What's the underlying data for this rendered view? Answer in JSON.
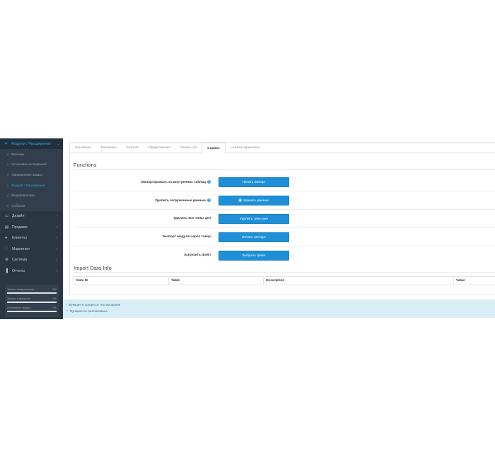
{
  "sidebar": {
    "header": {
      "label": "Модули / Расширения",
      "icon": "puzzle-icon"
    },
    "subitems": [
      {
        "label": "Магазин",
        "active": false
      },
      {
        "label": "Установка расширений",
        "active": false
      },
      {
        "label": "Оформление заказа",
        "active": false
      },
      {
        "label": "Модули / Расширения",
        "active": true
      },
      {
        "label": "Модификаторы",
        "active": false
      },
      {
        "label": "События",
        "active": false
      }
    ],
    "items": [
      {
        "label": "Дизайн",
        "icon": "monitor-icon"
      },
      {
        "label": "Продажи",
        "icon": "cart-icon"
      },
      {
        "label": "Клиенты",
        "icon": "user-icon"
      },
      {
        "label": "Маркетинг",
        "icon": "share-icon"
      },
      {
        "label": "Система",
        "icon": "gear-icon"
      },
      {
        "label": "Отчеты",
        "icon": "chart-icon"
      }
    ],
    "stats": [
      {
        "label": "Заказы завершенные",
        "pct": "0%",
        "value": 0
      },
      {
        "label": "Заказы в процессе",
        "pct": "0%",
        "value": 0
      },
      {
        "label": "Остальные заказы",
        "pct": "0%",
        "value": 0
      }
    ]
  },
  "tabs": [
    {
      "label": "Основные",
      "active": false
    },
    {
      "label": "Магазины",
      "active": false
    },
    {
      "label": "Каталог",
      "active": false
    },
    {
      "label": "Предложения",
      "active": false
    },
    {
      "label": "Заказы (0)",
      "active": false
    },
    {
      "label": "Сервис",
      "active": true
    },
    {
      "label": "License Agreement",
      "active": false
    }
  ],
  "functions": {
    "title": "Functions",
    "rows": [
      {
        "label": "Импортировать из внутренних таблиц",
        "help": true,
        "button": "Начать импорт",
        "trash": false
      },
      {
        "label": "Удалить загруженные данные",
        "help": true,
        "button": "Удалить данные",
        "trash": true
      },
      {
        "label": "Удалить все типы цен",
        "help": false,
        "button": "Удалить типы цен",
        "trash": false
      },
      {
        "label": "Экспорт модуля через товар",
        "help": false,
        "button": "Начать экспорт",
        "trash": false
      },
      {
        "label": "Загрузить файл",
        "help": false,
        "button": "Выбрать файл",
        "trash": false
      }
    ]
  },
  "import": {
    "title": "Import Data Info",
    "columns": [
      "Data ID",
      "Table",
      "Description",
      "Value"
    ]
  },
  "info": {
    "lines": [
      {
        "mark": "*",
        "text": "Функция в процессе тестирования"
      },
      {
        "mark": "**",
        "text": "Функция не реализована"
      }
    ]
  },
  "colors": {
    "accent": "#2fa4e7",
    "button": "#1f90d8",
    "sidebar": "#2b3643",
    "info_bg": "#d9edf7"
  }
}
